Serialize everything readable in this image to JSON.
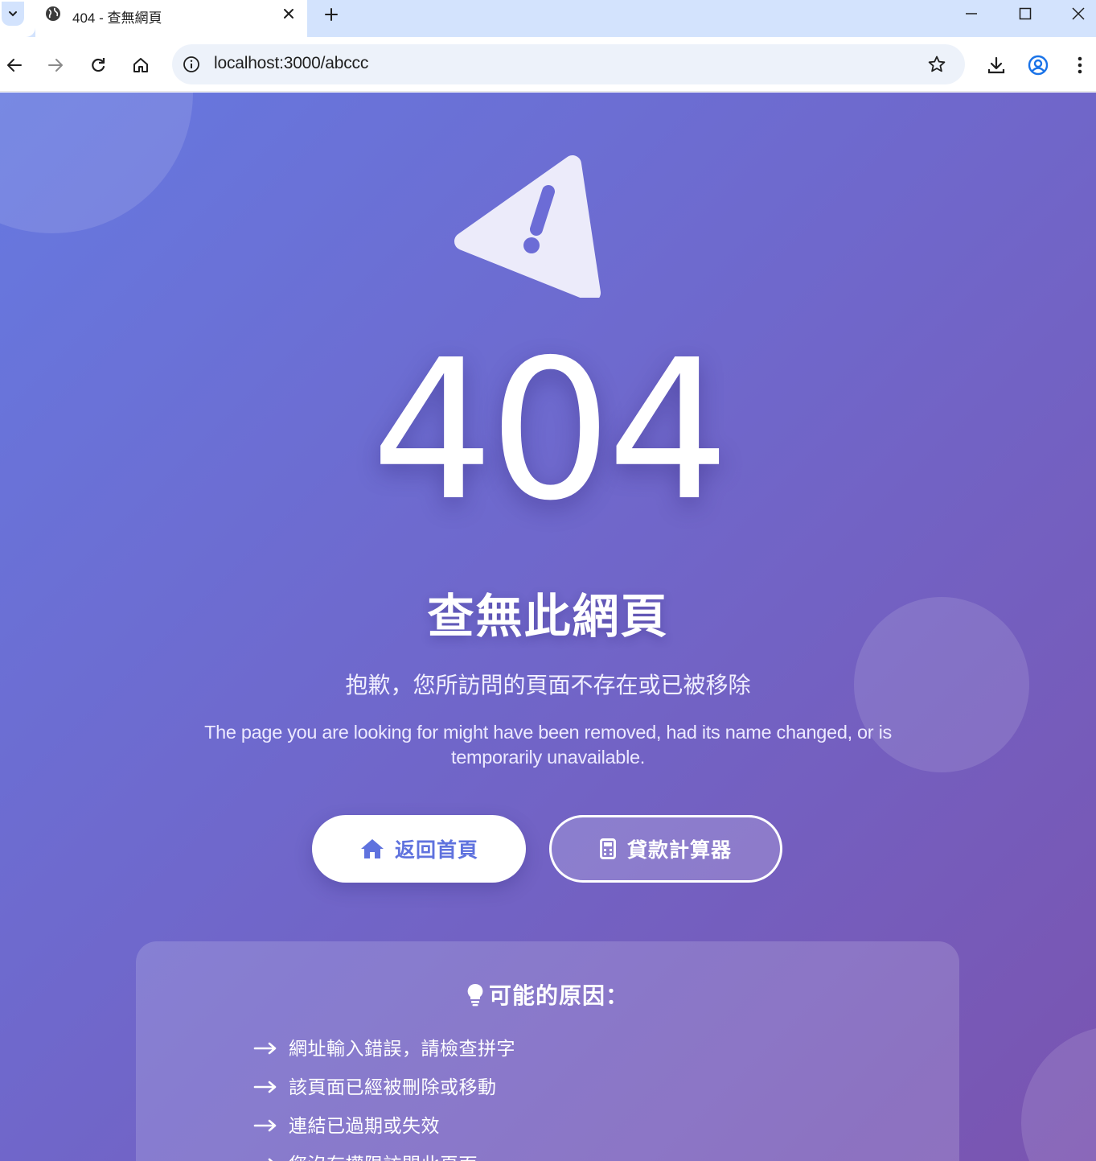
{
  "browser": {
    "tab_title": "404 - 查無網頁",
    "url": "localhost:3000/abccc",
    "icons": {
      "tab_menu": "chevron-down-icon",
      "tab_favicon": "globe-icon",
      "tab_close": "close-icon",
      "new_tab": "plus-icon",
      "back": "arrow-left-icon",
      "forward": "arrow-right-icon",
      "reload": "reload-icon",
      "home": "home-icon",
      "site_info": "info-icon",
      "bookmark": "star-icon",
      "downloads": "download-icon",
      "profile": "profile-icon",
      "menu": "kebab-menu-icon"
    }
  },
  "page": {
    "error_code": "404",
    "heading": "查無此網頁",
    "subtitle": "抱歉，您所訪問的頁面不存在或已被移除",
    "description": "The page you are looking for might have been removed, had its name changed, or is temporarily unavailable.",
    "buttons": {
      "home_label": "返回首頁",
      "calculator_label": "貸款計算器"
    },
    "reasons": {
      "title": "可能的原因：",
      "items": [
        "網址輸入錯誤，請檢查拼字",
        "該頁面已經被刪除或移動",
        "連結已過期或失效",
        "您沒有權限訪問此頁面"
      ]
    },
    "colors": {
      "gradient_start": "#6679e0",
      "gradient_end": "#7a54b0",
      "accent": "#5f72de",
      "text": "#ffffff"
    }
  }
}
